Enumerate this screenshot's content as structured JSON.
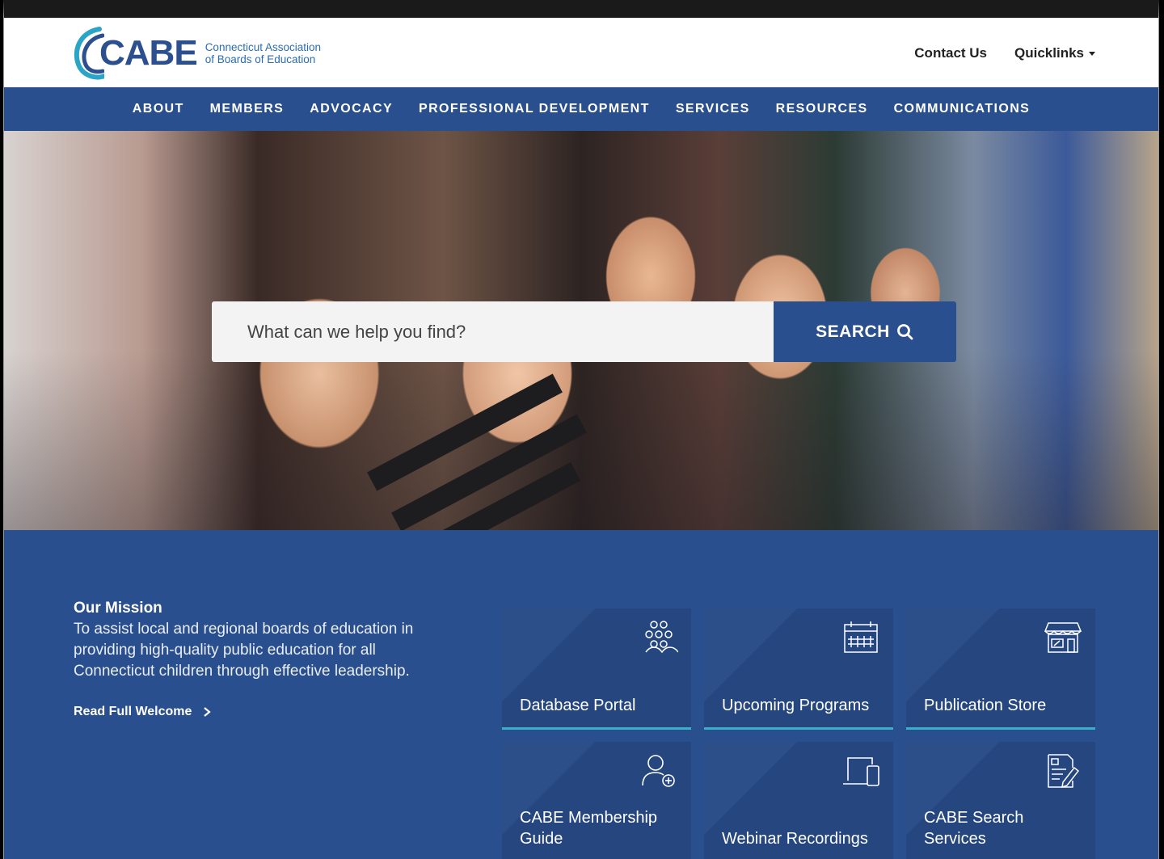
{
  "header": {
    "logo_word": "CABE",
    "logo_tagline_1": "Connecticut Association",
    "logo_tagline_2": "of Boards of Education",
    "contact_label": "Contact Us",
    "quicklinks_label": "Quicklinks"
  },
  "nav": {
    "items": [
      "ABOUT",
      "MEMBERS",
      "ADVOCACY",
      "PROFESSIONAL DEVELOPMENT",
      "SERVICES",
      "RESOURCES",
      "COMMUNICATIONS"
    ]
  },
  "search": {
    "placeholder": "What can we help you find?",
    "button_label": "SEARCH"
  },
  "mission": {
    "title": "Our Mission",
    "text": "To assist local and regional boards of education in providing high-quality public education for all Connecticut children through effective leadership.",
    "link_label": "Read Full Welcome"
  },
  "tiles": [
    {
      "label": "Database Portal",
      "icon": "people-group-icon"
    },
    {
      "label": "Upcoming Programs",
      "icon": "calendar-icon"
    },
    {
      "label": "Publication Store",
      "icon": "storefront-icon"
    },
    {
      "label": "CABE Membership Guide",
      "icon": "add-user-icon"
    },
    {
      "label": "Webinar Recordings",
      "icon": "devices-icon"
    },
    {
      "label": "CABE Search Services",
      "icon": "document-edit-icon"
    }
  ],
  "colors": {
    "brand_blue": "#2a4f8e",
    "accent_teal": "#3ab0c8"
  }
}
